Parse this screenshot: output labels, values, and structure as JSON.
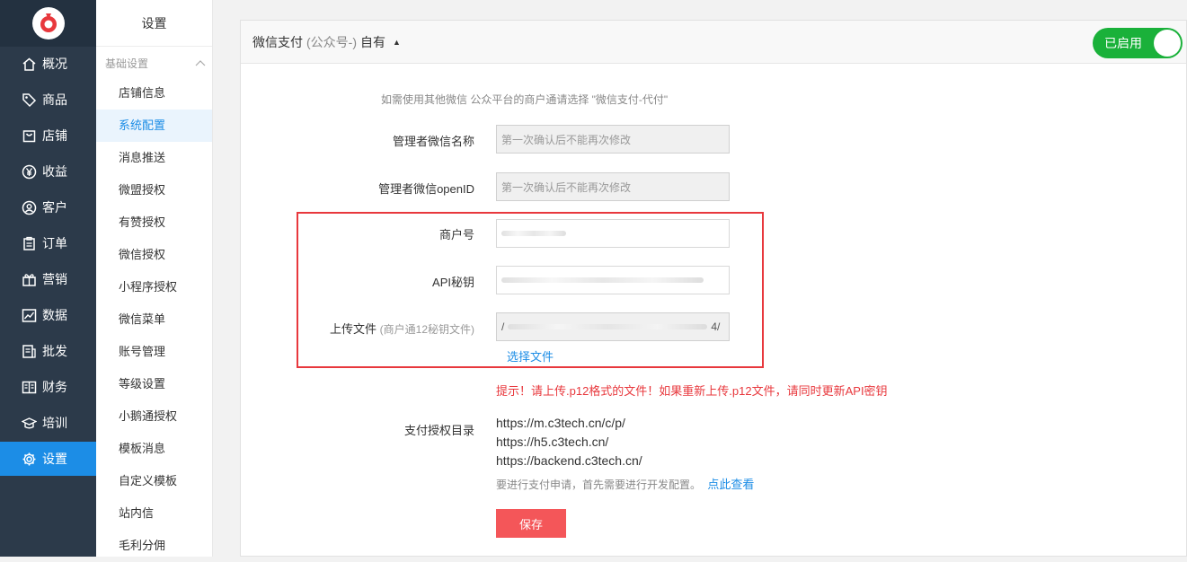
{
  "nav": {
    "items": [
      {
        "label": "概况",
        "icon": "home-icon"
      },
      {
        "label": "商品",
        "icon": "tag-icon"
      },
      {
        "label": "店铺",
        "icon": "shop-icon"
      },
      {
        "label": "收益",
        "icon": "yen-icon"
      },
      {
        "label": "客户",
        "icon": "user-icon"
      },
      {
        "label": "订单",
        "icon": "clipboard-icon"
      },
      {
        "label": "营销",
        "icon": "gift-icon"
      },
      {
        "label": "数据",
        "icon": "chart-icon"
      },
      {
        "label": "批发",
        "icon": "wholesale-icon"
      },
      {
        "label": "财务",
        "icon": "ledger-icon"
      },
      {
        "label": "培训",
        "icon": "graduation-icon"
      },
      {
        "label": "设置",
        "icon": "gear-icon"
      }
    ],
    "active_index": 11,
    "accent": "#1c8de6"
  },
  "subnav": {
    "title": "设置",
    "group": "基础设置",
    "items": [
      "店铺信息",
      "系统配置",
      "消息推送",
      "微盟授权",
      "有赞授权",
      "微信授权",
      "小程序授权",
      "微信菜单",
      "账号管理",
      "等级设置",
      "小鹅通授权",
      "模板消息",
      "自定义模板",
      "站内信",
      "毛利分佣"
    ],
    "active_index": 1
  },
  "panel": {
    "title_main": "微信支付",
    "title_paren": "(公众号-)",
    "title_suffix": "自有",
    "caret": "▲",
    "toggle_label": "已启用",
    "toggle_color": "#1ab13a"
  },
  "form": {
    "intro": "如需使用其他微信 公众平台的商户通请选择 \"微信支付-代付\"",
    "admin_name": {
      "label": "管理者微信名称",
      "placeholder": "第一次确认后不能再次修改"
    },
    "admin_openid": {
      "label": "管理者微信openID",
      "placeholder": "第一次确认后不能再次修改"
    },
    "merchant_id": {
      "label": "商户号"
    },
    "api_key": {
      "label": "API秘钥"
    },
    "upload": {
      "label": "上传文件",
      "hint": "(商户通12秘钥文件)",
      "value_prefix": "/",
      "value_suffix": "4/",
      "choose_label": "选择文件"
    },
    "warning": "提示！请上传.p12格式的文件！如果重新上传.p12文件，请同时更新API密钥",
    "auth_dir": {
      "label": "支付授权目录",
      "urls": [
        "https://m.c3tech.cn/c/p/",
        "https://h5.c3tech.cn/",
        "https://backend.c3tech.cn/"
      ],
      "note": "要进行支付申请，首先需要进行开发配置。",
      "note_link": "点此查看"
    },
    "save_label": "保存",
    "danger_color": "#f45659"
  }
}
